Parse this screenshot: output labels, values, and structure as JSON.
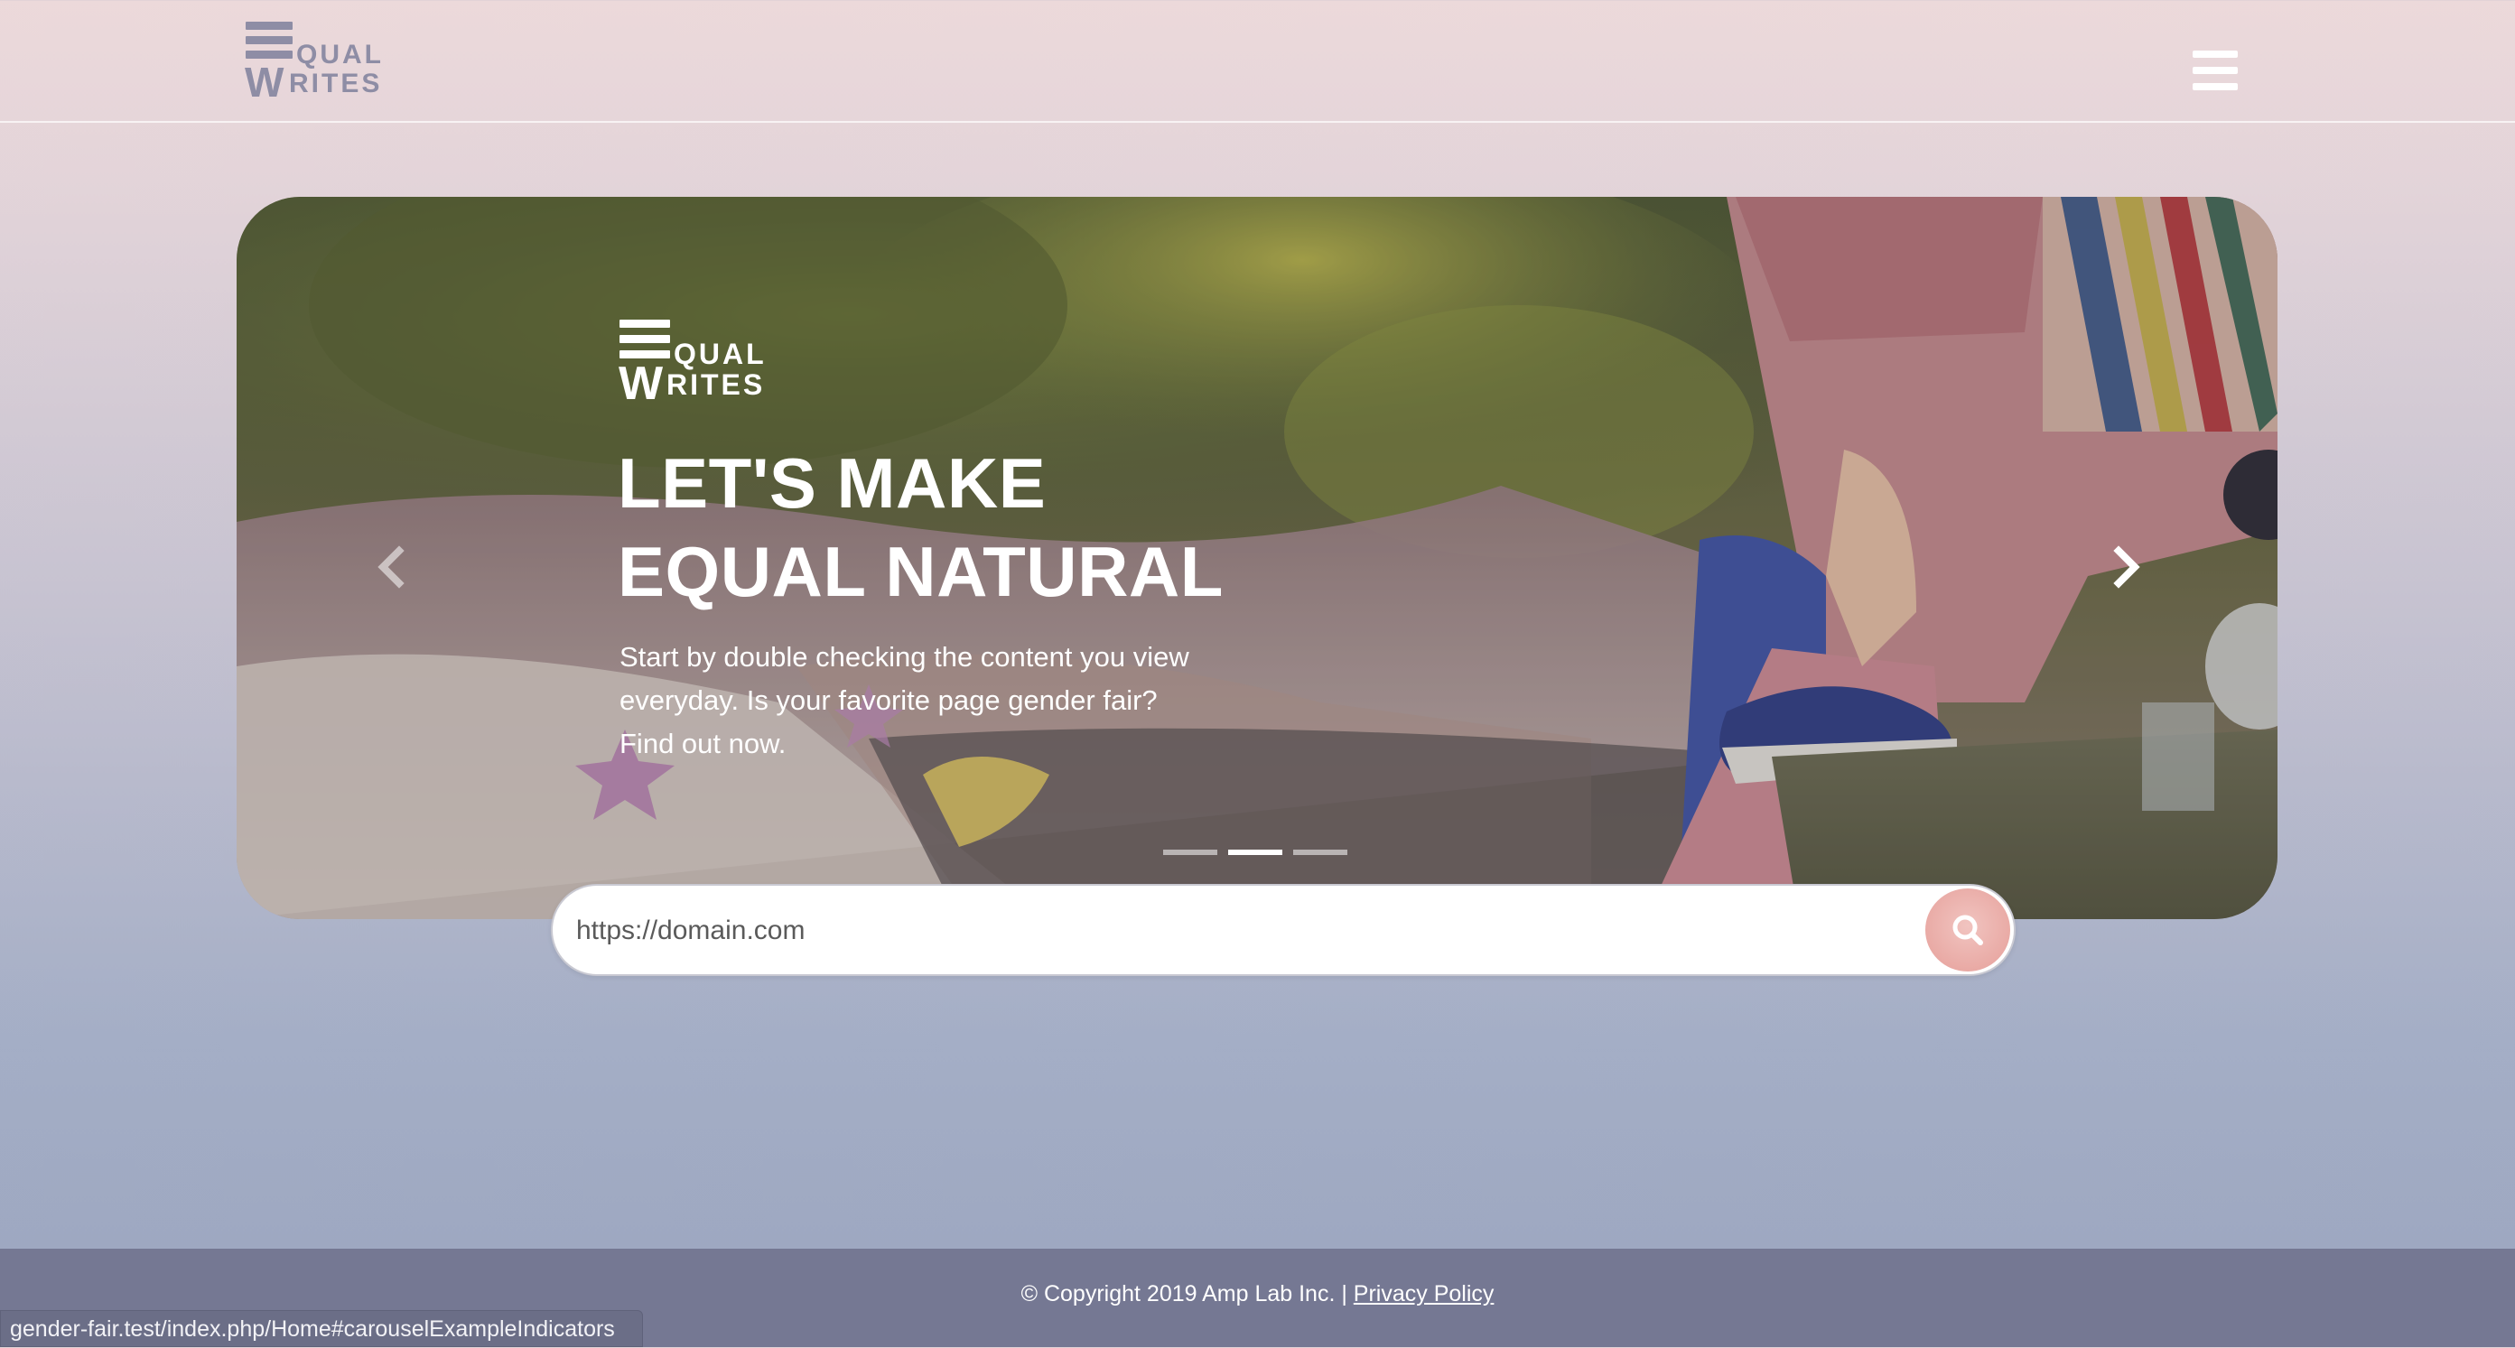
{
  "header": {
    "logo": {
      "letter": "W",
      "text_top": "QUAL",
      "text_bottom": "RITES"
    },
    "menu_icon": "hamburger-icon"
  },
  "carousel": {
    "logo": {
      "letter": "W",
      "text_top": "QUAL",
      "text_bottom": "RITES"
    },
    "headline_line1": "LET'S MAKE",
    "headline_line2": "EQUAL NATURAL",
    "subtext_line1": "Start by double checking the content you view",
    "subtext_line2": "everyday. Is your favorite page gender fair?",
    "subtext_line3": "Find out now.",
    "prev_icon": "chevron-left-icon",
    "next_icon": "chevron-right-icon",
    "slide_count": 3,
    "active_slide": 2
  },
  "search": {
    "placeholder": "https://domain.com",
    "value": "",
    "button_icon": "search-icon"
  },
  "footer": {
    "copyright": "© Copyright 2019 Amp Lab Inc. | ",
    "privacy_link": "Privacy Policy"
  },
  "status_bar": {
    "url": "gender-fair.test/index.php/Home#carouselExampleIndicators"
  },
  "colors": {
    "logo_header": "#8e8da5",
    "footer_bg": "#757893",
    "search_button": "#e9aaa5"
  }
}
